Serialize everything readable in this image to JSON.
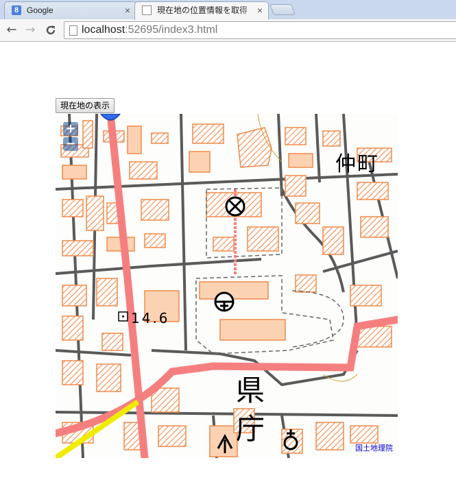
{
  "browser": {
    "tabs": [
      {
        "title": "Google",
        "active": false,
        "favicon": "google-favicon"
      },
      {
        "title": "現在地の位置情報を取得",
        "active": true,
        "favicon": "page-favicon"
      }
    ],
    "close_glyph": "×",
    "address": {
      "host": "localhost",
      "rest": ":52695/index3.html"
    },
    "nav": {
      "back": "←",
      "forward": "→",
      "reload": "C"
    }
  },
  "page": {
    "show_location_button": "現在地の表示",
    "map": {
      "zoom_in": "+",
      "zoom_out": "−",
      "attribution": "国土地理院",
      "elevation_label": "14.6",
      "big_label_1": "県",
      "big_label_2": "庁",
      "top_label": "仲町",
      "colors": {
        "building_fill": "#fbd3b3",
        "building_outline": "#f08a4b",
        "road_red": "#f58080",
        "road_yellow": "#f2f000",
        "road_edge": "#555555",
        "zoom_control": "#5577aa",
        "marker_blue": "#2f6cf0"
      }
    }
  }
}
